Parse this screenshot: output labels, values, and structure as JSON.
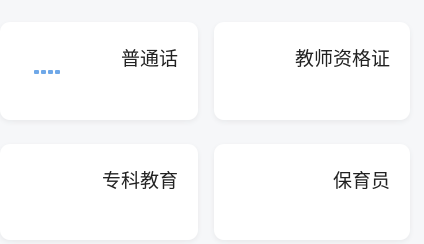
{
  "cards": [
    {
      "title": "普通话"
    },
    {
      "title": "教师资格证"
    },
    {
      "title": "专科教育"
    },
    {
      "title": "保育员"
    }
  ],
  "colors": {
    "background": "#f6f7f9",
    "card": "#ffffff",
    "text": "#222222",
    "accent": "#6fa8e8"
  }
}
